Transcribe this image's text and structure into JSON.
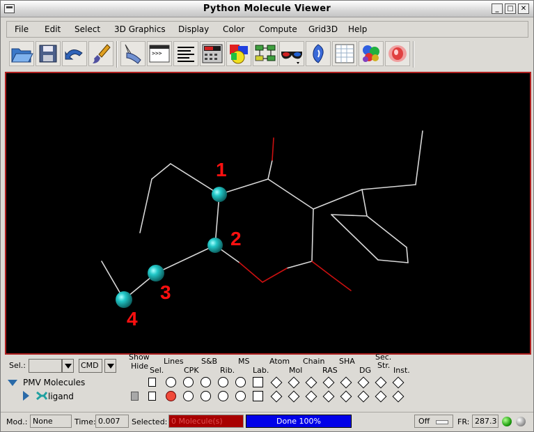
{
  "window": {
    "title": "Python Molecule Viewer"
  },
  "menu": [
    "File",
    "Edit",
    "Select",
    "3D Graphics",
    "Display",
    "Color",
    "Compute",
    "Grid3D",
    "Help"
  ],
  "toolbar_icons": [
    "open-file-icon",
    "save-icon",
    "undo-icon",
    "paint-brush-icon",
    "pick-tool-icon",
    "python-shell-icon",
    "text-lines-icon",
    "control-panel-icon",
    "color-shapes-icon",
    "network-icon",
    "stereo-glasses-icon",
    "pdb-logo-icon",
    "spreadsheet-icon",
    "molecule-surface-icon",
    "volume-render-icon"
  ],
  "viewer": {
    "labels": [
      "1",
      "2",
      "3",
      "4"
    ],
    "label_color": "#ff1010",
    "atom_color": "#18b5b5",
    "bond_color": "#d8d8d8",
    "oxygen_color": "#cc1010"
  },
  "selector": {
    "label": "Sel.:",
    "value": "",
    "cmd_value": "CMD"
  },
  "tree": {
    "root": "PMV Molecules",
    "child": "ligand"
  },
  "columns": {
    "show_hide": [
      "Show",
      "Hide"
    ],
    "top": [
      "Lines",
      "S&B",
      "MS",
      "Atom",
      "Chain",
      "SHA",
      "Sec.",
      "Str."
    ],
    "bottom": [
      "Sel.",
      "CPK",
      "Rib.",
      "Lab.",
      "Mol",
      "RAS",
      "DG",
      "Inst."
    ]
  },
  "status": {
    "mod_label": "Mod.:",
    "mod_value": "None",
    "time_label": "Time:",
    "time_value": "0.007",
    "selected_label": "Selected:",
    "selected_value": "0 Molecule(s)",
    "progress_text": "Done 100%",
    "progress_fraction": 1.0,
    "spin_value": "Off",
    "fr_label": "FR:",
    "fr_value": "287.3"
  }
}
